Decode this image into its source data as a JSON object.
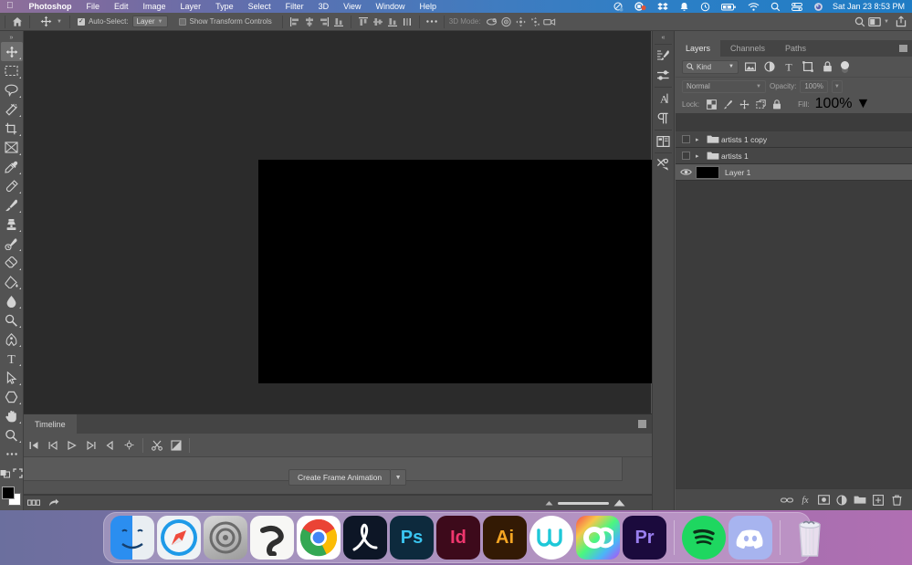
{
  "menubar": {
    "apple_icon": "apple-icon",
    "items": [
      {
        "label": "Photoshop",
        "bold": true
      },
      {
        "label": "File",
        "bold": false
      },
      {
        "label": "Edit",
        "bold": false
      },
      {
        "label": "Image",
        "bold": false
      },
      {
        "label": "Layer",
        "bold": false
      },
      {
        "label": "Type",
        "bold": false
      },
      {
        "label": "Select",
        "bold": false
      },
      {
        "label": "Filter",
        "bold": false
      },
      {
        "label": "3D",
        "bold": false
      },
      {
        "label": "View",
        "bold": false
      },
      {
        "label": "Window",
        "bold": false
      },
      {
        "label": "Help",
        "bold": false
      }
    ],
    "status_icons": [
      "vpn-off-icon",
      "record-stop-icon",
      "dropbox-icon",
      "notification-bell-icon",
      "time-machine-icon",
      "battery-charging-icon",
      "wifi-icon",
      "spotlight-search-icon",
      "control-center-icon",
      "siri-icon"
    ],
    "clock": "Sat Jan 23  8:53 PM"
  },
  "options_bar": {
    "home_icon": "home-icon",
    "tool_icon": "move-tool-icon",
    "auto_select_checked": true,
    "auto_select_label": "Auto-Select:",
    "auto_select_value": "Layer",
    "show_transform_checked": false,
    "show_transform_label": "Show Transform Controls",
    "align_icons": [
      "align-left-edges-icon",
      "align-horizontal-centers-icon",
      "align-right-edges-icon",
      "align-top-edges-icon",
      "align-vertical-centers-icon",
      "align-bottom-edges-icon"
    ],
    "distribute_icons": [
      "distribute-top-edges-icon",
      "distribute-vertical-centers-icon",
      "distribute-bottom-edges-icon",
      "distribute-horizontal-centers-icon"
    ],
    "more_icon": "more-options-icon",
    "mode_3d_label": "3D Mode:",
    "mode_3d_icons": [
      "3d-orbit-icon",
      "3d-roll-icon",
      "3d-pan-icon",
      "3d-slide-icon",
      "3d-camera-icon"
    ],
    "right_icons": [
      "search-icon",
      "workspace-switcher-icon",
      "chevron-down-icon",
      "share-icon"
    ]
  },
  "toolbar": {
    "collapse_icon": "collapse-panel-icon",
    "tools": [
      {
        "name": "move-tool",
        "active": true
      },
      {
        "name": "rectangular-marquee-tool",
        "active": false
      },
      {
        "name": "lasso-tool",
        "active": false
      },
      {
        "name": "magic-wand-tool",
        "active": false
      },
      {
        "name": "crop-tool",
        "active": false
      },
      {
        "name": "frame-tool",
        "active": false
      },
      {
        "name": "eyedropper-tool",
        "active": false
      },
      {
        "name": "spot-healing-brush-tool",
        "active": false
      },
      {
        "name": "brush-tool",
        "active": false
      },
      {
        "name": "clone-stamp-tool",
        "active": false
      },
      {
        "name": "history-brush-tool",
        "active": false
      },
      {
        "name": "eraser-tool",
        "active": false
      },
      {
        "name": "gradient-tool",
        "active": false
      },
      {
        "name": "blur-tool",
        "active": false
      },
      {
        "name": "dodge-tool",
        "active": false
      },
      {
        "name": "pen-tool",
        "active": false
      },
      {
        "name": "type-tool",
        "active": false
      },
      {
        "name": "path-selection-tool",
        "active": false
      },
      {
        "name": "shape-tool",
        "active": false
      },
      {
        "name": "hand-tool",
        "active": false
      },
      {
        "name": "zoom-tool",
        "active": false
      },
      {
        "name": "edit-toolbar-tool",
        "active": false
      }
    ],
    "quick_mask_icon": "quick-mask-icon",
    "screen_mode_icon": "screen-mode-icon",
    "foreground_color": "#000000",
    "background_color": "#ffffff"
  },
  "dock_strip": {
    "collapse_icon": "collapse-dock-icon",
    "icons": [
      "brush-settings-icon",
      "adjustments-icon",
      "character-panel-icon",
      "paragraph-panel-icon",
      "libraries-icon",
      "actions-icon"
    ]
  },
  "canvas": {
    "document_color": "#000000"
  },
  "timeline": {
    "tab_label": "Timeline",
    "panel_menu_icon": "panel-menu-icon",
    "transport": [
      "go-to-first-frame-icon",
      "previous-frame-icon",
      "play-icon",
      "next-frame-icon",
      "audio-icon",
      "settings-gear-icon"
    ],
    "tools": [
      "split-at-playhead-icon",
      "transition-icon"
    ],
    "create_button_label": "Create Frame Animation",
    "create_button_chevron": "chevron-down-icon",
    "footer_icons": [
      "convert-to-frame-animation-icon",
      "render-video-icon"
    ],
    "zoom_out_icon": "zoom-out-small-icon",
    "zoom_in_icon": "zoom-in-large-icon"
  },
  "layers_panel": {
    "tabs": [
      {
        "label": "Layers",
        "active": true
      },
      {
        "label": "Channels",
        "active": false
      },
      {
        "label": "Paths",
        "active": false
      }
    ],
    "panel_menu_icon": "panel-menu-icon",
    "filter": {
      "search_icon": "search-icon",
      "kind_label": "Kind",
      "chevron": "chevron-down-icon",
      "type_icons": [
        "filter-pixel-icon",
        "filter-adjustment-icon",
        "filter-type-icon",
        "filter-shape-icon",
        "filter-smart-object-icon"
      ],
      "toggle_name": "filter-enable-toggle"
    },
    "blend": {
      "mode": "Normal",
      "mode_chevron": "chevron-down-icon",
      "opacity_label": "Opacity:",
      "opacity_value": "100%",
      "opacity_chevron": "chevron-down-icon"
    },
    "lock": {
      "label": "Lock:",
      "icons": [
        "lock-transparent-pixels-icon",
        "lock-image-pixels-icon",
        "lock-position-icon",
        "lock-artboard-nesting-icon",
        "lock-all-icon"
      ],
      "fill_label": "Fill:",
      "fill_value": "100%",
      "fill_chevron": "chevron-down-icon"
    },
    "layers": [
      {
        "name": "artists 1 copy",
        "type": "group",
        "visible": false,
        "selected": false,
        "expanded": false
      },
      {
        "name": "artists 1",
        "type": "group",
        "visible": false,
        "selected": false,
        "expanded": false
      },
      {
        "name": "Layer 1",
        "type": "pixel",
        "visible": true,
        "selected": true,
        "thumb_color": "#000000"
      }
    ],
    "footer_icons": [
      "link-layers-icon",
      "layer-style-fx-icon",
      "add-layer-mask-icon",
      "new-adjustment-layer-icon",
      "new-group-icon",
      "new-layer-icon",
      "delete-layer-icon"
    ]
  },
  "macos_dock": {
    "apps": [
      {
        "name": "Finder",
        "running": true
      },
      {
        "name": "Safari",
        "running": true
      },
      {
        "name": "System Preferences",
        "running": false
      },
      {
        "name": "Clip Studio Paint",
        "running": false
      },
      {
        "name": "Google Chrome",
        "running": true
      },
      {
        "name": "Adobe Acrobat",
        "running": false
      },
      {
        "name": "Adobe Photoshop",
        "running": true,
        "label": "Ps"
      },
      {
        "name": "Adobe InDesign",
        "running": false,
        "label": "Id"
      },
      {
        "name": "Adobe Illustrator",
        "running": false,
        "label": "Ai"
      },
      {
        "name": "Wacom",
        "running": false
      },
      {
        "name": "Creative Cloud",
        "running": false
      },
      {
        "name": "Adobe Premiere Pro",
        "running": false,
        "label": "Pr"
      },
      {
        "name": "Spotify",
        "running": true
      },
      {
        "name": "Discord",
        "running": true
      },
      {
        "name": "Trash",
        "running": false
      }
    ]
  }
}
